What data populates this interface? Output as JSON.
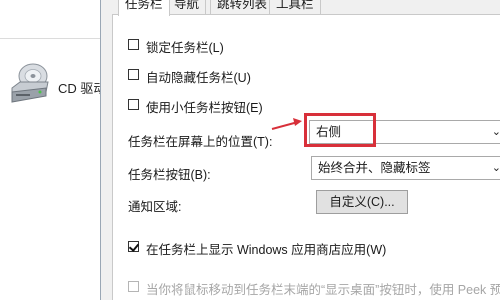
{
  "explorer": {
    "drive_label": "CD 驱动",
    "drive_icon": "cd-drive-icon"
  },
  "tabs": [
    {
      "label": "任务栏"
    },
    {
      "label": "导航"
    },
    {
      "label": "跳转列表"
    },
    {
      "label": "工具栏"
    }
  ],
  "options": {
    "lock_taskbar": {
      "label": "锁定任务栏(L)",
      "checked": false
    },
    "auto_hide": {
      "label": "自动隐藏任务栏(U)",
      "checked": false
    },
    "small_buttons": {
      "label": "使用小任务栏按钮(E)",
      "checked": false
    },
    "show_store_apps": {
      "label": "在任务栏上显示 Windows 应用商店应用(W)",
      "checked": true
    },
    "peek": {
      "label": "当你将鼠标移动到任务栏末端的“显示桌面”按钮时，使用 Peek 预览",
      "checked": false,
      "disabled": true
    }
  },
  "position": {
    "label": "任务栏在屏幕上的位置(T):",
    "value": "右侧"
  },
  "buttons_combine": {
    "label": "任务栏按钮(B):",
    "value": "始终合并、隐藏标签"
  },
  "notification": {
    "label": "通知区域:",
    "button": "自定义(C)..."
  },
  "colors": {
    "highlight": "#d8303a",
    "arrow": "#d8303a"
  }
}
